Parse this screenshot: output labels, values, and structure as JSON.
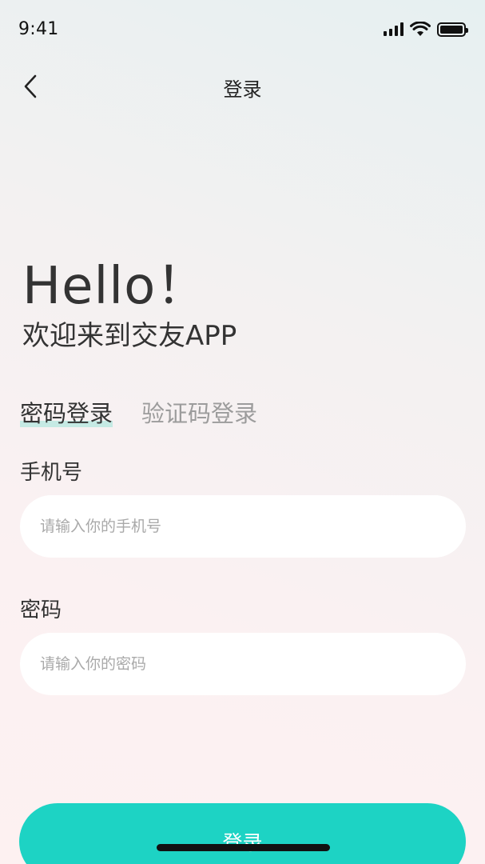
{
  "status_bar": {
    "time": "9:41"
  },
  "nav": {
    "title": "登录"
  },
  "hero": {
    "greeting": "Hello！",
    "welcome": "欢迎来到交友APP"
  },
  "tabs": [
    {
      "label": "密码登录",
      "active": true
    },
    {
      "label": "验证码登录",
      "active": false
    }
  ],
  "form": {
    "phone": {
      "label": "手机号",
      "value": "",
      "placeholder": "请输入你的手机号"
    },
    "password": {
      "label": "密码",
      "value": "",
      "placeholder": "请输入你的密码"
    }
  },
  "login_button": {
    "label": "登录"
  },
  "colors": {
    "accent": "#1dd3c4",
    "tab_highlight": "#bfe9e2"
  },
  "icons": [
    "signal-icon",
    "wifi-icon",
    "battery-icon",
    "back-chevron-icon"
  ]
}
